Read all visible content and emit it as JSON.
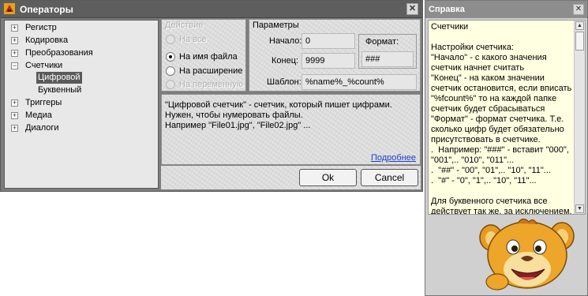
{
  "dialog": {
    "title": "Операторы",
    "tree": [
      {
        "label": "Регистр",
        "expander": "+"
      },
      {
        "label": "Кодировка",
        "expander": "+"
      },
      {
        "label": "Преобразования",
        "expander": "+"
      },
      {
        "label": "Счетчики",
        "expander": "−"
      },
      {
        "label": "Цифровой",
        "selected": true
      },
      {
        "label": "Буквенный"
      },
      {
        "label": "Триггеры",
        "expander": "+"
      },
      {
        "label": "Медиа",
        "expander": "+"
      },
      {
        "label": "Диалоги",
        "expander": "+"
      }
    ],
    "action_group": {
      "title": "Действие",
      "options": [
        {
          "label": "На все",
          "checked": false,
          "enabled": false
        },
        {
          "label": "На имя файла",
          "checked": true,
          "enabled": true
        },
        {
          "label": "На расширение",
          "checked": false,
          "enabled": true
        },
        {
          "label": "На переменную",
          "checked": false,
          "enabled": false
        }
      ]
    },
    "params_group": {
      "title": "Параметры",
      "start_label": "Начало:",
      "start_value": "0",
      "end_label": "Конец:",
      "end_value": "9999",
      "format_label": "Формат:",
      "format_value": "###",
      "template_label": "Шаблон:",
      "template_value": "%name%_%count%"
    },
    "description": [
      "\"Цифровой счетчик\" - счетчик, который пишет цифрами.",
      "Нужен, чтобы нумеровать файлы.",
      "Например \"File01.jpg\", \"File02.jpg\" ..."
    ],
    "more_link": "Подробнее",
    "ok_label": "Ok",
    "cancel_label": "Cancel"
  },
  "help": {
    "title": "Справка",
    "text": "Счетчики\n\nНастройки счетчика:\n\"Начало\" - с какого значения счетчик начнет считать\n\"Конец\" - на каком значении счетчик остановится, если вписать \"%fcount%\" то на каждой папке счетчик будет сбрасываться\n\"Формат\" - формат счетчика. Т.е. сколько цифр будет обязательно присутствовать в счетчике.\n.  Например: \"###\" - вставит \"000\", \"001\",.. \"010\", \"011\"...\n.  \"##\" - \"00\", \"01\",.. \"10\", \"11\"...\n.  \"#\" - \"0\", \"1\",.. \"10\", \"11\"...\n\nДля буквенного счетчика все действует так же, за исключением,"
  }
}
